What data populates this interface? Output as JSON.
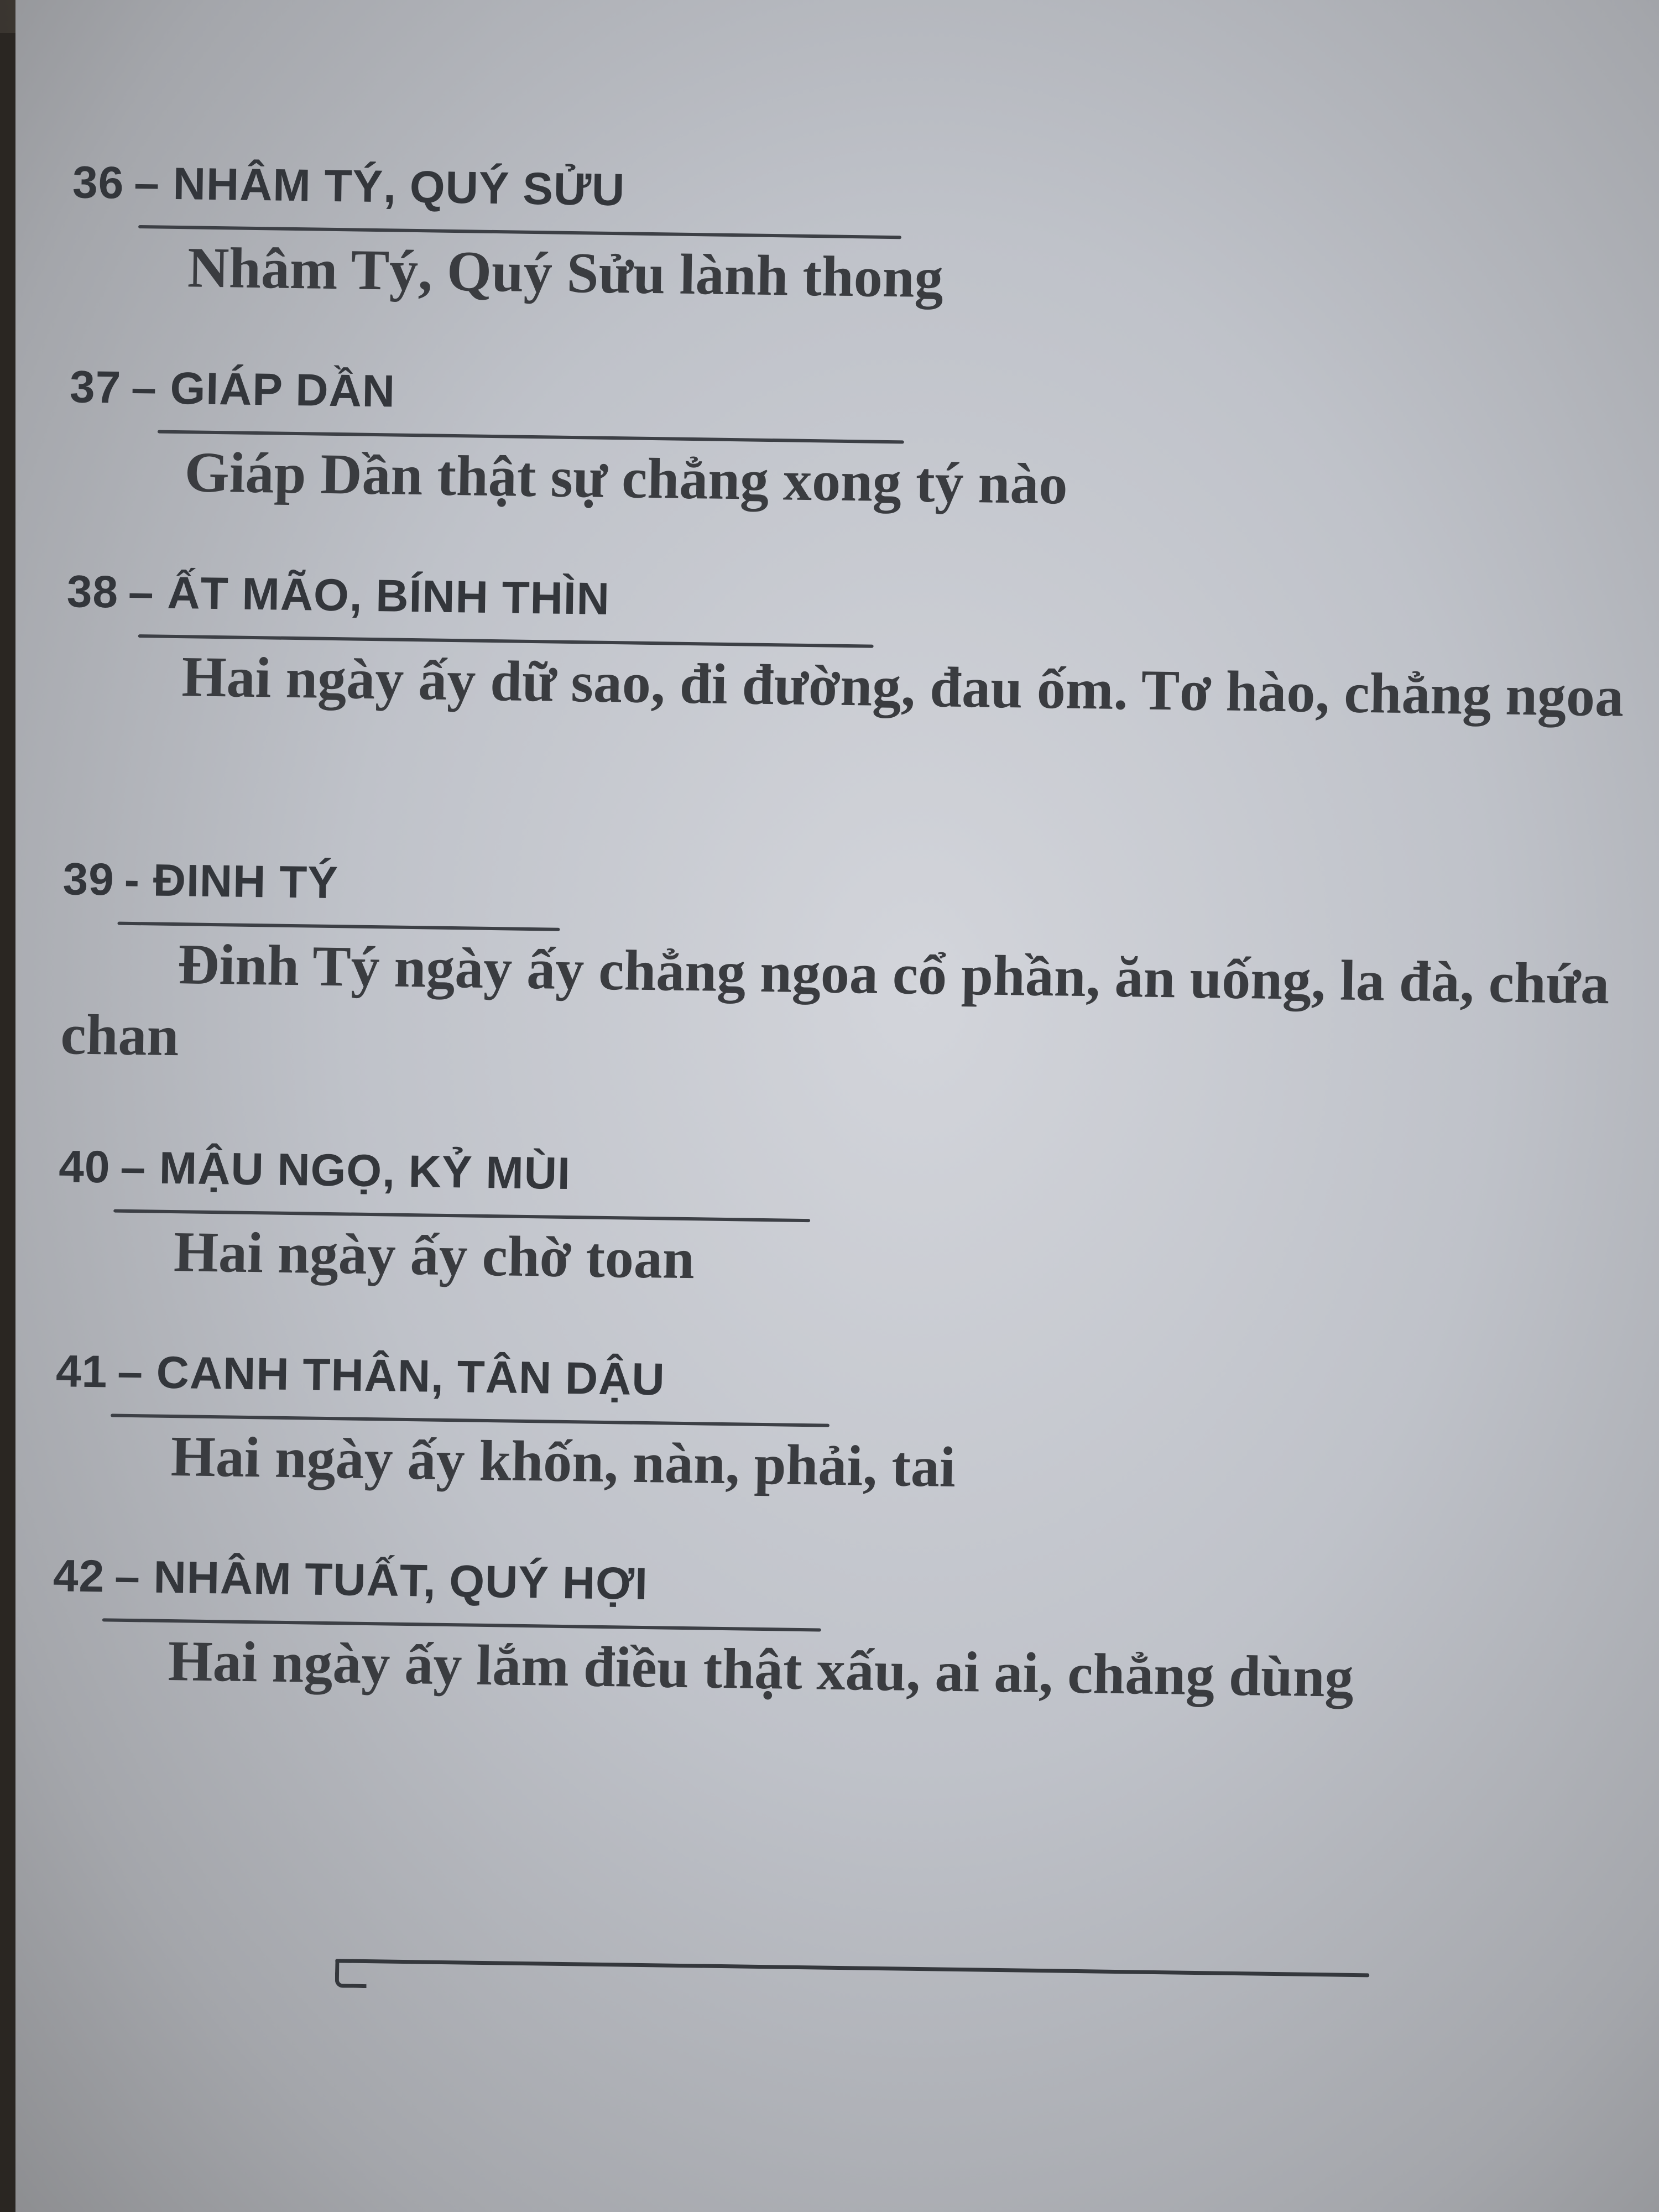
{
  "entries": [
    {
      "number": "36",
      "sep": "–",
      "title": "NHÂM TÝ, QUÝ SỬU",
      "text": "Nhâm Tý, Quý Sửu lành thong"
    },
    {
      "number": "37",
      "sep": "–",
      "title": "GIÁP DẦN",
      "text": "Giáp Dần thật sự chẳng xong tý nào"
    },
    {
      "number": "38",
      "sep": "–",
      "title": "ẤT MÃO, BÍNH THÌN",
      "text": "Hai ngày ấy dữ sao, đi đường, đau ốm. Tơ hào, chẳng ngoa"
    },
    {
      "number": "39",
      "sep": "-",
      "title": "ĐINH TÝ",
      "text": "Đinh Tý ngày ấy chẳng ngoa cổ phần, ăn uống, la đà, chứa chan"
    },
    {
      "number": "40",
      "sep": "–",
      "title": "MẬU NGỌ, KỶ MÙI",
      "text": "Hai ngày ấy chờ toan"
    },
    {
      "number": "41",
      "sep": "–",
      "title": "CANH THÂN, TÂN DẬU",
      "text": "Hai ngày ấy khốn, nàn, phải, tai"
    },
    {
      "number": "42",
      "sep": "–",
      "title": "NHÂM TUẤT, QUÝ HỢI",
      "text": "Hai ngày ấy lắm điều thật xấu, ai ai, chẳng dùng"
    }
  ]
}
